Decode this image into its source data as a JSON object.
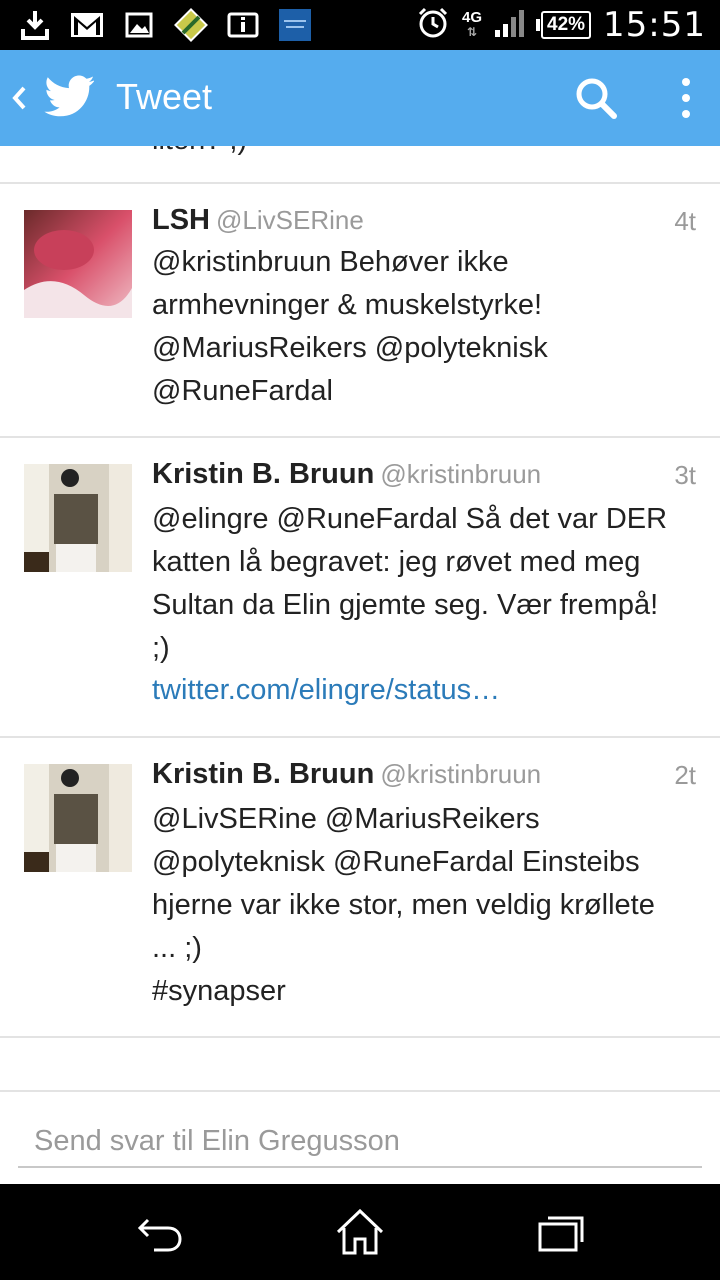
{
  "status_bar": {
    "time": "15:51",
    "battery": "42%",
    "network": "4G",
    "icons": [
      "download-icon",
      "gmail-icon",
      "gallery-icon",
      "app-icon",
      "info-icon",
      "xperia-lounge-icon",
      "alarm-icon",
      "signal-icon"
    ]
  },
  "action_bar": {
    "title": "Tweet",
    "back_icon": "chevron-left-icon",
    "logo_icon": "twitter-bird-icon",
    "search_icon": "search-icon",
    "more_icon": "overflow-menu-icon",
    "color": "#55acee"
  },
  "clipped_text": "liten? ;)",
  "tweets": [
    {
      "name": "LSH",
      "handle": "@LivSERine",
      "time": "4t",
      "text": "@kristinbruun Behøver ikke\narmhevninger & muskelstyrke!\n@MariusReikers @polyteknisk\n@RuneFardal"
    },
    {
      "name": "Kristin B. Bruun",
      "handle": "@kristinbruun",
      "time": "3t",
      "text": "@elingre @RuneFardal Så det var DER\nkatten lå begravet: jeg røvet med meg\nSultan da Elin gjemte seg. Vær frempå!\n;)",
      "link": "twitter.com/elingre/status…"
    },
    {
      "name": "Kristin B. Bruun",
      "handle": "@kristinbruun",
      "time": "2t",
      "text": "@LivSERine @MariusReikers\n@polyteknisk @RuneFardal Einsteibs\nhjerne var ikke stor, men veldig krøllete\n... ;)\n#synapser"
    }
  ],
  "reply": {
    "placeholder": "Send svar til Elin Gregusson"
  },
  "nav_bar": {
    "back": "back-icon",
    "home": "home-icon",
    "recents": "recent-apps-icon"
  },
  "link_color": "#2b7bb9"
}
